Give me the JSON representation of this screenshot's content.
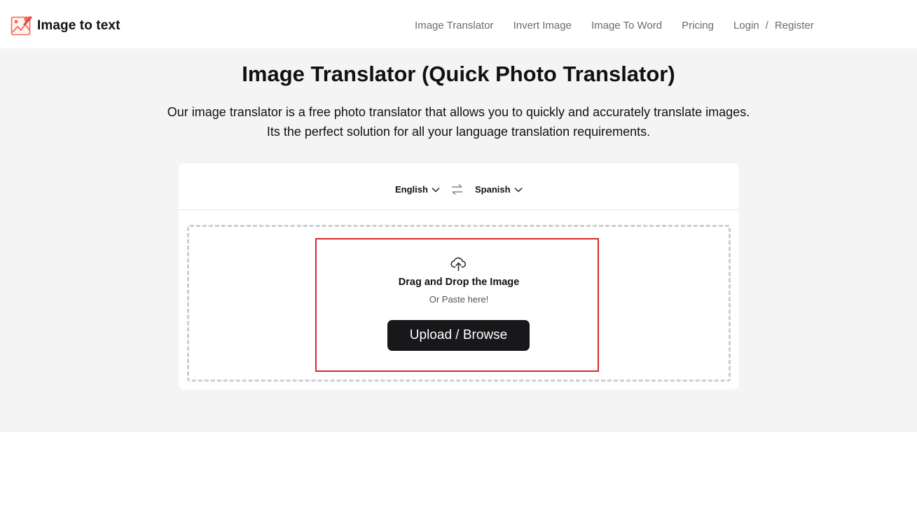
{
  "header": {
    "logo_text": "Image to text",
    "logo_icon": "image-chart-icon",
    "nav": [
      {
        "label": "Image Translator"
      },
      {
        "label": "Invert Image"
      },
      {
        "label": "Image To Word"
      },
      {
        "label": "Pricing"
      }
    ],
    "login_label": "Login",
    "separator": "/",
    "register_label": "Register"
  },
  "hero": {
    "title": "Image Translator (Quick Photo Translator)",
    "description": "Our image translator is a free photo translator that allows you to quickly and accurately translate images. Its the perfect solution for all your language translation requirements."
  },
  "translator": {
    "source_language": "English",
    "target_language": "Spanish",
    "swap_icon": "swap-arrows-icon",
    "upload_icon": "cloud-upload-icon",
    "dropzone_title": "Drag and Drop the Image",
    "dropzone_subtitle": "Or Paste here!",
    "upload_button_label": "Upload / Browse"
  },
  "colors": {
    "hero_background": "#f4f4f4",
    "button_background": "#18181b",
    "highlight_border": "#d62a2a",
    "logo_accent": "#f26b5b"
  }
}
